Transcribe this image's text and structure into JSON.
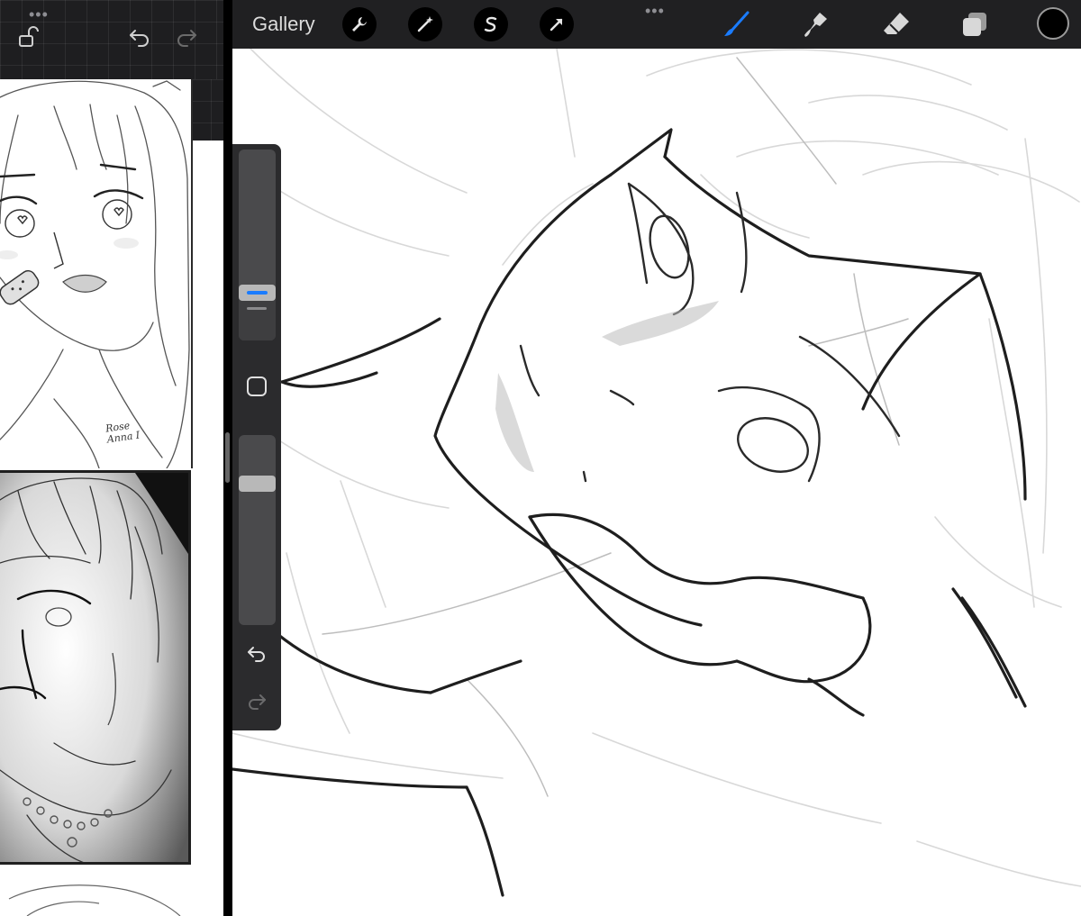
{
  "left_app": {
    "toolbar": {
      "more_icon": "ellipsis-icon",
      "lock_icon": "unlock-icon",
      "undo_icon": "undo-arrow-icon",
      "redo_icon": "redo-arrow-icon"
    },
    "artworks": [
      {
        "name": "girl-with-bandage-sketch",
        "signature": "Rose\nAnna I"
      },
      {
        "name": "shaded-portrait-sketch"
      },
      {
        "name": "partial-sketch"
      }
    ]
  },
  "procreate": {
    "top_bar": {
      "gallery_label": "Gallery",
      "left_tools": [
        "wrench-icon",
        "magic-wand-icon",
        "selection-s-icon",
        "transform-arrow-icon"
      ],
      "more_icon": "ellipsis-icon",
      "right_tools": [
        "brush-icon",
        "smudge-icon",
        "eraser-icon",
        "layers-icon"
      ],
      "active_tool": "brush-icon",
      "accent_color": "#1a7cff",
      "current_color": "#000000"
    },
    "sidebar": {
      "brush_size_level": 0.27,
      "brush_opacity_level": 0.76,
      "modify_icon": "square-modify-icon",
      "undo_icon": "undo-arrow-icon",
      "redo_icon": "redo-arrow-icon"
    },
    "canvas": {
      "subject": "line-art-sketch"
    }
  }
}
